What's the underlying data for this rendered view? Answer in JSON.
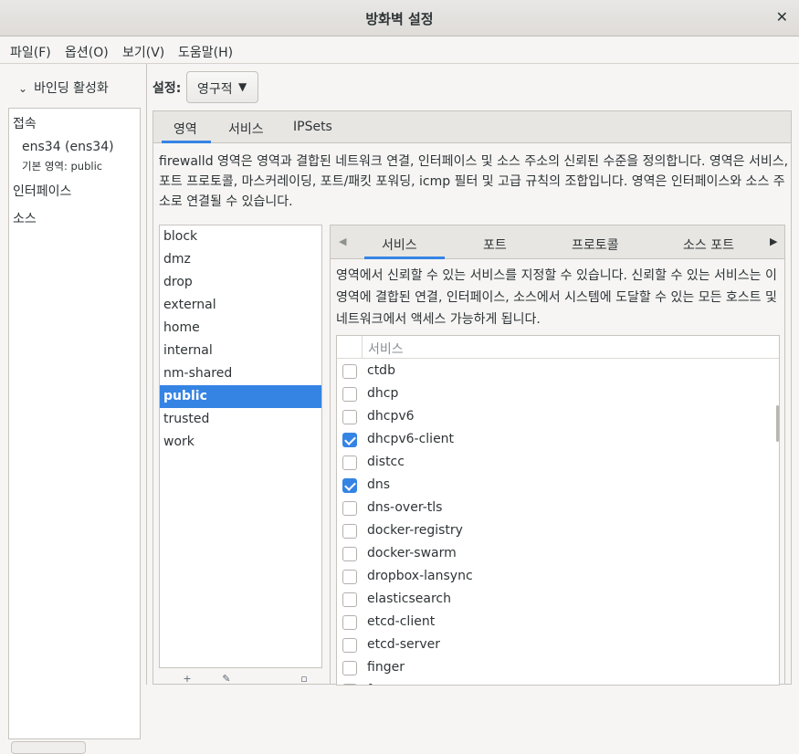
{
  "window": {
    "title": "방화벽 설정"
  },
  "menu": [
    "파일(F)",
    "옵션(O)",
    "보기(V)",
    "도움말(H)"
  ],
  "left": {
    "binding_label": "바인딩 활성화",
    "connections_heading": "접속",
    "connection_name": "ens34 (ens34)",
    "default_zone": "기본 영역: public",
    "interfaces_heading": "인터페이스",
    "sources_heading": "소스"
  },
  "settings": {
    "label": "설정:",
    "mode": "영구적"
  },
  "outer_tabs": [
    "영역",
    "서비스",
    "IPSets"
  ],
  "zone_description": "firewalld 영역은 영역과 결합된 네트워크 연결, 인터페이스 및 소스 주소의 신뢰된 수준을 정의합니다. 영역은 서비스, 포트 프로토콜, 마스커레이딩, 포트/패킷 포워딩, icmp 필터 및 고급 규칙의 조합입니다. 영역은 인터페이스와 소스 주소로 연결될 수 있습니다.",
  "zones": [
    "block",
    "dmz",
    "drop",
    "external",
    "home",
    "internal",
    "nm-shared",
    "public",
    "trusted",
    "work"
  ],
  "selected_zone": "public",
  "inner_tabs": [
    "서비스",
    "포트",
    "프로토콜",
    "소스 포트"
  ],
  "service_description": "영역에서 신뢰할 수 있는 서비스를 지정할 수 있습니다. 신뢰할 수 있는 서비스는 이 영역에 결합된 연결, 인터페이스, 소스에서 시스템에 도달할 수 있는 모든 호스트 및 네트워크에서 액세스 가능하게 됩니다.",
  "service_column": "서비스",
  "services": [
    {
      "name": "ctdb",
      "checked": false
    },
    {
      "name": "dhcp",
      "checked": false
    },
    {
      "name": "dhcpv6",
      "checked": false
    },
    {
      "name": "dhcpv6-client",
      "checked": true
    },
    {
      "name": "distcc",
      "checked": false
    },
    {
      "name": "dns",
      "checked": true
    },
    {
      "name": "dns-over-tls",
      "checked": false
    },
    {
      "name": "docker-registry",
      "checked": false
    },
    {
      "name": "docker-swarm",
      "checked": false
    },
    {
      "name": "dropbox-lansync",
      "checked": false
    },
    {
      "name": "elasticsearch",
      "checked": false
    },
    {
      "name": "etcd-client",
      "checked": false
    },
    {
      "name": "etcd-server",
      "checked": false
    },
    {
      "name": "finger",
      "checked": false
    },
    {
      "name": "f",
      "checked": false
    }
  ],
  "colors": {
    "accent": "#3584e4"
  }
}
